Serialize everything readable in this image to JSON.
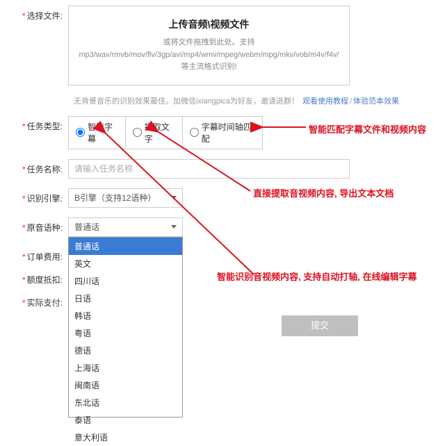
{
  "labels": {
    "select_file": "选择文件:",
    "task_type": "任务类型:",
    "task_name": "任务名称:",
    "engine": "识别引擎:",
    "lang": "原音语种:",
    "order_fee": "订单费用:",
    "quota": "额度抵扣:",
    "actual": "实际支付:"
  },
  "upload": {
    "title": "上传音频\\视频文件",
    "sub": "或将文件拖拽到此处。支持mp3/wav/rmvb/mov/flv/3gp/avi/mp4/wmv/mpeg/webm/mpg/mkv/vob/m4v/f4v/等主流格式识别!"
  },
  "hint": {
    "text": "无背景音乐的识别效果最佳。加微信ixiangpica为好友，邀请进群！",
    "link1": "观看使用教程",
    "sep": "/",
    "link2": "体验范本效果"
  },
  "radios": {
    "r1": "智能字幕",
    "r2": "提取文字",
    "r3": "字幕时间轴匹配"
  },
  "task_name_placeholder": "请输入任务名称",
  "engine_value": "B引擎（支持12语种）",
  "lang_value": "普通话",
  "lang_options": [
    "普通话",
    "英文",
    "四川话",
    "日语",
    "韩语",
    "粤语",
    "德语",
    "上海话",
    "闽南语",
    "东北话",
    "泰语",
    "意大利语"
  ],
  "submit": "提交",
  "annotations": {
    "a1": "智能匹配字幕文件和视频内容",
    "a2": "直接提取音视频内容, 导出文本文档",
    "a3": "智能识别音视频内容, 支持自动打轴, 在线编辑字幕"
  }
}
